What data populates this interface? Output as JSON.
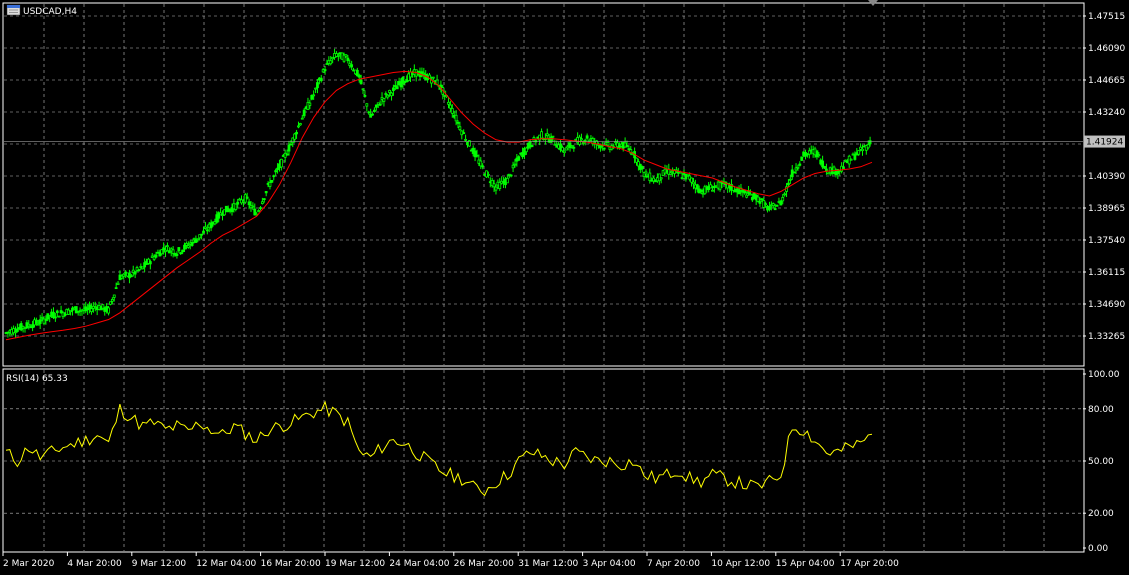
{
  "window": {
    "symbol": "USDCAD,H4",
    "indicator_label": "RSI(14) 65.33"
  },
  "colors": {
    "background": "#000000",
    "grid": "#c0c0c0",
    "candles": "#00ff00",
    "moving_average": "#ff0000",
    "rsi_line": "#ffff00",
    "axis_text": "#ffffff",
    "current_price_bg": "#c0c0c0"
  },
  "price_axis": {
    "ticks": [
      "1.47515",
      "1.46090",
      "1.44665",
      "1.43240",
      "1.41924",
      "1.40390",
      "1.38965",
      "1.37540",
      "1.36115",
      "1.34690",
      "1.33265"
    ],
    "current_price": "1.41924"
  },
  "rsi_axis": {
    "ticks": [
      "100.00",
      "80.00",
      "50.00",
      "20.00",
      "0.00"
    ]
  },
  "time_axis": {
    "labels": [
      "2 Mar 2020",
      "4 Mar 20:00",
      "9 Mar 12:00",
      "12 Mar 04:00",
      "16 Mar 20:00",
      "19 Mar 12:00",
      "24 Mar 04:00",
      "26 Mar 20:00",
      "31 Mar 12:00",
      "3 Apr 04:00",
      "7 Apr 20:00",
      "10 Apr 12:00",
      "15 Apr 04:00",
      "17 Apr 20:00"
    ]
  },
  "chart_data": {
    "type": "line",
    "title": "USDCAD,H4",
    "price_range": [
      1.3255,
      1.4785
    ],
    "price_series": {
      "name": "USDCAD,H4",
      "values": [
        1.334,
        1.336,
        1.3375,
        1.339,
        1.342,
        1.343,
        1.3445,
        1.344,
        1.346,
        1.344,
        1.359,
        1.36,
        1.363,
        1.368,
        1.372,
        1.37,
        1.373,
        1.377,
        1.382,
        1.388,
        1.39,
        1.394,
        1.387,
        1.399,
        1.408,
        1.418,
        1.43,
        1.44,
        1.452,
        1.458,
        1.456,
        1.448,
        1.43,
        1.438,
        1.442,
        1.447,
        1.45,
        1.448,
        1.445,
        1.435,
        1.424,
        1.415,
        1.406,
        1.399,
        1.402,
        1.412,
        1.418,
        1.422,
        1.42,
        1.415,
        1.419,
        1.421,
        1.418,
        1.417,
        1.418,
        1.415,
        1.405,
        1.402,
        1.406,
        1.405,
        1.403,
        1.397,
        1.399,
        1.4,
        1.398,
        1.396,
        1.394,
        1.389,
        1.392,
        1.405,
        1.413,
        1.415,
        1.407,
        1.406,
        1.411,
        1.415,
        1.4192
      ]
    },
    "moving_average": {
      "name": "MA",
      "values": [
        1.331,
        1.332,
        1.333,
        1.3338,
        1.3345,
        1.3352,
        1.336,
        1.337,
        1.3385,
        1.34,
        1.343,
        1.347,
        1.351,
        1.355,
        1.359,
        1.363,
        1.3665,
        1.37,
        1.374,
        1.3775,
        1.38,
        1.383,
        1.386,
        1.392,
        1.4,
        1.41,
        1.421,
        1.43,
        1.437,
        1.442,
        1.445,
        1.447,
        1.448,
        1.449,
        1.45,
        1.4505,
        1.45,
        1.448,
        1.444,
        1.438,
        1.432,
        1.427,
        1.423,
        1.42,
        1.419,
        1.419,
        1.42,
        1.4205,
        1.4205,
        1.42,
        1.4195,
        1.419,
        1.418,
        1.417,
        1.416,
        1.414,
        1.411,
        1.409,
        1.407,
        1.406,
        1.405,
        1.404,
        1.403,
        1.401,
        1.399,
        1.3975,
        1.396,
        1.395,
        1.397,
        1.4,
        1.403,
        1.405,
        1.406,
        1.4065,
        1.407,
        1.408,
        1.41
      ]
    },
    "rsi": {
      "name": "RSI(14)",
      "value": 65.33,
      "range": [
        0,
        100
      ],
      "levels": [
        80,
        50,
        20
      ],
      "values": [
        55,
        50,
        58,
        52,
        55,
        58,
        60,
        62,
        65,
        60,
        80,
        75,
        70,
        72,
        68,
        70,
        67,
        72,
        68,
        65,
        70,
        66,
        62,
        68,
        70,
        72,
        75,
        78,
        80,
        77,
        72,
        55,
        52,
        58,
        62,
        60,
        55,
        50,
        45,
        42,
        40,
        35,
        33,
        38,
        42,
        50,
        55,
        53,
        50,
        48,
        55,
        52,
        50,
        50,
        48,
        50,
        42,
        40,
        42,
        45,
        40,
        38,
        42,
        40,
        38,
        36,
        35,
        38,
        42,
        70,
        68,
        62,
        55,
        55,
        58,
        60,
        65.33
      ]
    },
    "x_tick_labels": [
      "2 Mar 2020",
      "4 Mar 20:00",
      "9 Mar 12:00",
      "12 Mar 04:00",
      "16 Mar 20:00",
      "19 Mar 12:00",
      "24 Mar 04:00",
      "26 Mar 20:00",
      "31 Mar 12:00",
      "3 Apr 04:00",
      "7 Apr 20:00",
      "10 Apr 12:00",
      "15 Apr 04:00",
      "17 Apr 20:00"
    ],
    "y_tick_labels": [
      "1.47515",
      "1.46090",
      "1.44665",
      "1.43240",
      "1.41924",
      "1.40390",
      "1.38965",
      "1.37540",
      "1.36115",
      "1.34690",
      "1.33265"
    ],
    "grid": true
  }
}
